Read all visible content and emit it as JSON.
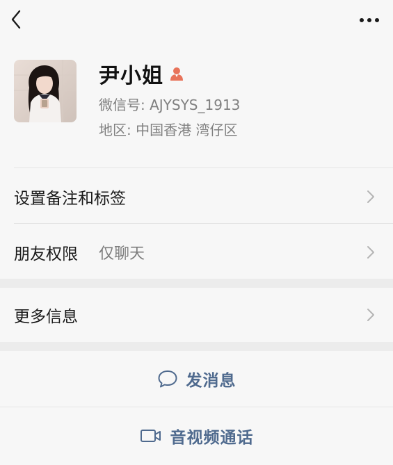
{
  "profile": {
    "name": "尹小姐",
    "wechat_id": "微信号: AJYSYS_1913",
    "region": "地区: 中国香港  湾仔区"
  },
  "menu": {
    "remark_tags": "设置备注和标签",
    "friend_permission": "朋友权限",
    "friend_permission_value": "仅聊天",
    "more_info": "更多信息"
  },
  "actions": {
    "send_message": "发消息",
    "video_call": "音视频通话"
  },
  "icons": {
    "back": "chevron-left-icon",
    "more": "more-dots-icon",
    "profile": "person-icon",
    "chevron": "chevron-right-icon",
    "message": "speech-bubble-icon",
    "video": "video-camera-icon"
  },
  "colors": {
    "accent": "#4f6a8e",
    "profile_icon": "#e8735a",
    "secondary_text": "#808080"
  }
}
